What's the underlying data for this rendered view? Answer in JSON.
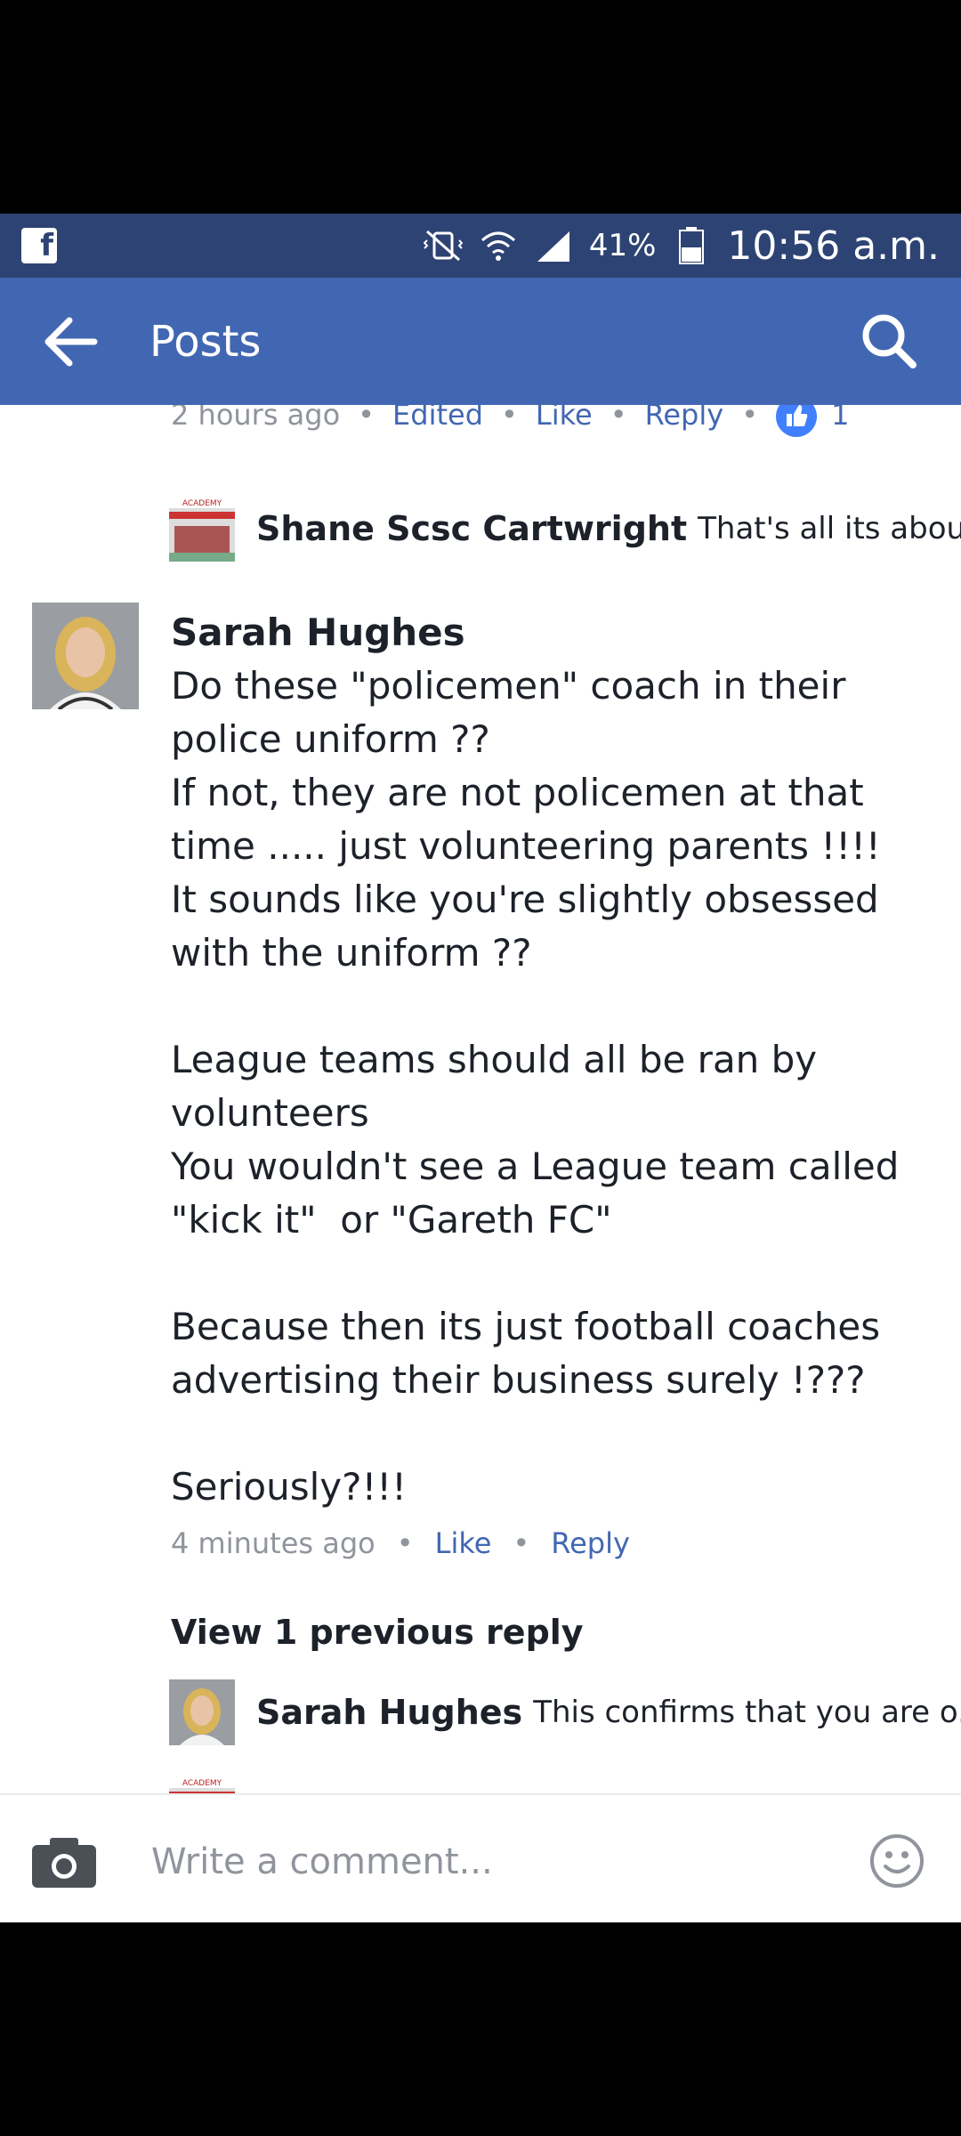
{
  "status_bar": {
    "battery": "41%",
    "time": "10:56 a.m."
  },
  "app_bar": {
    "title": "Posts"
  },
  "top_meta": {
    "time": "2 hours ago",
    "edited": "Edited",
    "like": "Like",
    "reply": "Reply",
    "reaction_count": "1"
  },
  "reply_1": {
    "author": "Shane Scsc Cartwright",
    "preview": "That's all its abou..."
  },
  "comment": {
    "author": "Sarah Hughes",
    "text": "Do these \"policemen\" coach in their\npolice uniform ??\nIf not, they are not policemen at that\ntime ..... just volunteering parents !!!!\nIt sounds like you're slightly obsessed\nwith the uniform ??\n\nLeague teams should all be ran by\nvolunteers\nYou wouldn't see a League team called\n\"kick it\"  or \"Gareth FC\"\n\nBecause then its just football coaches\nadvertising their business surely !???\n\nSeriously?!!!",
    "time": "4 minutes ago",
    "like": "Like",
    "reply": "Reply"
  },
  "view_previous": "View 1 previous reply",
  "reply_2": {
    "author": "Sarah Hughes",
    "preview": "This confirms that you are o..."
  },
  "composer": {
    "placeholder": "Write a comment..."
  },
  "colors": {
    "status_bar": "#2d4373",
    "app_bar": "#4267b2",
    "link": "#4267b2",
    "meta_gray": "#90949c"
  }
}
